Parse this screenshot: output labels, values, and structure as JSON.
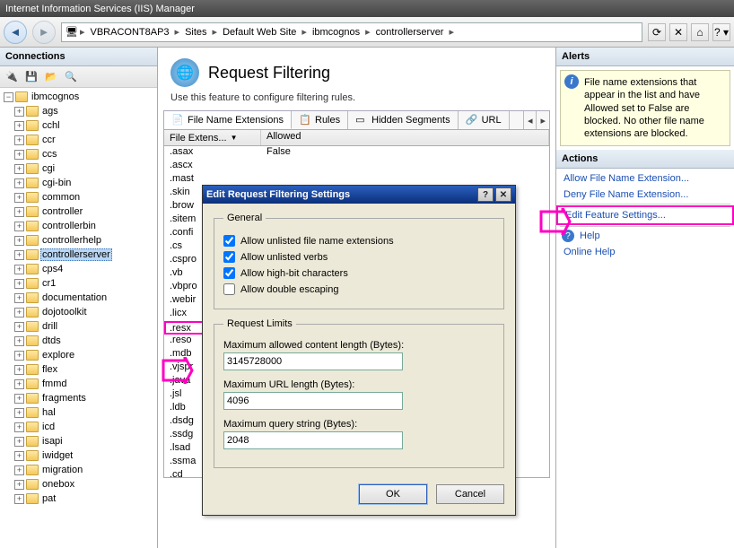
{
  "window": {
    "title": "Internet Information Services (IIS) Manager"
  },
  "breadcrumb": {
    "items": [
      "VBRACONT8AP3",
      "Sites",
      "Default Web Site",
      "ibmcognos",
      "controllerserver"
    ]
  },
  "panels": {
    "connections": "Connections",
    "alerts": "Alerts",
    "actions": "Actions"
  },
  "tree": {
    "root": "ibmcognos",
    "items": [
      "ags",
      "cchl",
      "ccr",
      "ccs",
      "cgi",
      "cgi-bin",
      "common",
      "controller",
      "controllerbin",
      "controllerhelp",
      "controllerserver",
      "cps4",
      "cr1",
      "documentation",
      "dojotoolkit",
      "drill",
      "dtds",
      "explore",
      "flex",
      "fmmd",
      "fragments",
      "hal",
      "icd",
      "isapi",
      "iwidget",
      "migration",
      "onebox",
      "pat"
    ],
    "selected": "controllerserver"
  },
  "feature": {
    "title": "Request Filtering",
    "desc": "Use this feature to configure filtering rules.",
    "tabs": [
      "File Name Extensions",
      "Rules",
      "Hidden Segments",
      "URL"
    ],
    "columns": {
      "c1": "File Extens...",
      "c2": "Allowed"
    },
    "c2sample": "False",
    "rows": [
      ".asax",
      ".ascx",
      ".mast",
      ".skin",
      ".brow",
      ".sitem",
      ".confi",
      ".cs",
      ".cspro",
      ".vb",
      ".vbpro",
      ".webir",
      ".licx",
      ".resx",
      ".reso",
      ".mdb",
      ".vjspr",
      ".java",
      ".jsl",
      ".ldb",
      ".dsdg",
      ".ssdg",
      ".lsad",
      ".ssma",
      ".cd"
    ],
    "highlighted_row": ".resx"
  },
  "dialog": {
    "title": "Edit Request Filtering Settings",
    "groups": {
      "general": "General",
      "limits": "Request Limits"
    },
    "checks": {
      "unlisted_ext": "Allow unlisted file name extensions",
      "unlisted_verbs": "Allow unlisted verbs",
      "highbit": "Allow high-bit characters",
      "double_esc": "Allow double escaping"
    },
    "checked": {
      "unlisted_ext": true,
      "unlisted_verbs": true,
      "highbit": true,
      "double_esc": false
    },
    "fields": {
      "max_content": {
        "label": "Maximum allowed content length (Bytes):",
        "value": "3145728000"
      },
      "max_url": {
        "label": "Maximum URL length (Bytes):",
        "value": "4096"
      },
      "max_query": {
        "label": "Maximum query string (Bytes):",
        "value": "2048"
      }
    },
    "buttons": {
      "ok": "OK",
      "cancel": "Cancel"
    }
  },
  "alert_text": "File name extensions that appear in the list and have Allowed set to False are blocked. No other file name extensions are blocked.",
  "actions": {
    "allow": "Allow File Name Extension...",
    "deny": "Deny File Name Extension...",
    "edit": "Edit Feature Settings...",
    "help": "Help",
    "online": "Online Help"
  }
}
